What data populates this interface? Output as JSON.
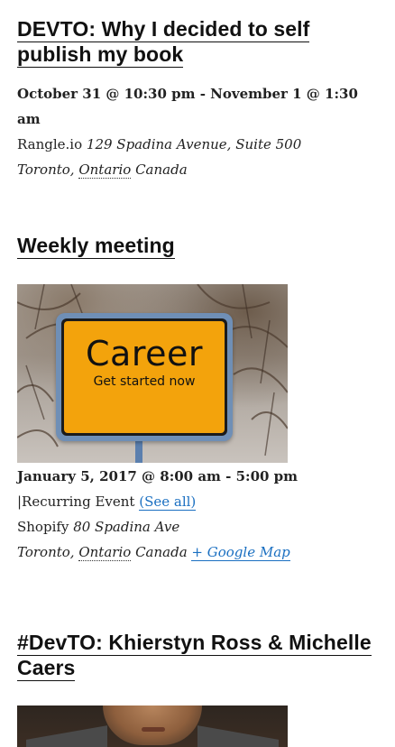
{
  "events": [
    {
      "title": "DEVTO: Why I decided to self publish my book",
      "dates": "October 31 @ 10:30 pm - November 1 @ 1:30 am",
      "venue_name": "Rangle.io",
      "address": "129 Spadina Avenue, Suite 500",
      "city": "Toronto",
      "region": "Ontario",
      "country": "Canada"
    },
    {
      "title": "Weekly meeting",
      "image": {
        "sign_big": "Career",
        "sign_small": "Get started now"
      },
      "dates": "January 5, 2017 @ 8:00 am - 5:00 pm",
      "recurring_prefix": "|Recurring Event",
      "see_all": "(See all)",
      "venue_name": "Shopify",
      "address": "80 Spadina Ave",
      "city": "Toronto",
      "region": "Ontario",
      "country": "Canada",
      "map_link": "+ Google Map"
    },
    {
      "title": "#DevTO: Khierstyn Ross & Michelle Caers"
    }
  ]
}
